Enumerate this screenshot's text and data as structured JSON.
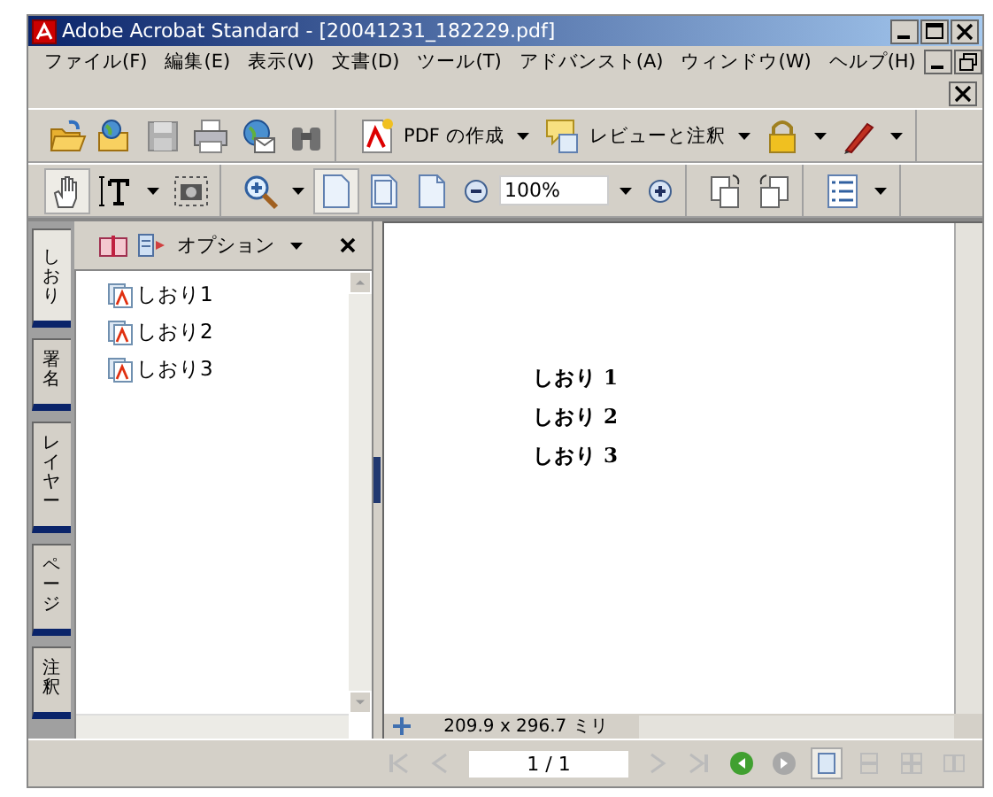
{
  "window": {
    "title": "Adobe Acrobat Standard - [20041231_182229.pdf]"
  },
  "menu": [
    {
      "label": "ファイル(F)"
    },
    {
      "label": "編集(E)"
    },
    {
      "label": "表示(V)"
    },
    {
      "label": "文書(D)"
    },
    {
      "label": "ツール(T)"
    },
    {
      "label": "アドバンスト(A)"
    },
    {
      "label": "ウィンドウ(W)"
    },
    {
      "label": "ヘルプ(H)"
    }
  ],
  "toolbar": {
    "create_pdf": "PDF の作成",
    "review": "レビューと注釈",
    "zoom": "100%"
  },
  "side_tabs": [
    {
      "label": "しおり",
      "selected": true
    },
    {
      "label": "署名",
      "selected": false
    },
    {
      "label": "レイヤー",
      "selected": false
    },
    {
      "label": "ページ",
      "selected": false
    },
    {
      "label": "注釈",
      "selected": false
    }
  ],
  "panel": {
    "options": "オプション",
    "bookmarks": [
      {
        "label": "しおり1"
      },
      {
        "label": "しおり2"
      },
      {
        "label": "しおり3"
      }
    ]
  },
  "document": {
    "lines": [
      "しおり 1",
      "しおり 2",
      "しおり 3"
    ],
    "page_size": "209.9 x 296.7 ミリ"
  },
  "navigation": {
    "page": "1 / 1"
  }
}
